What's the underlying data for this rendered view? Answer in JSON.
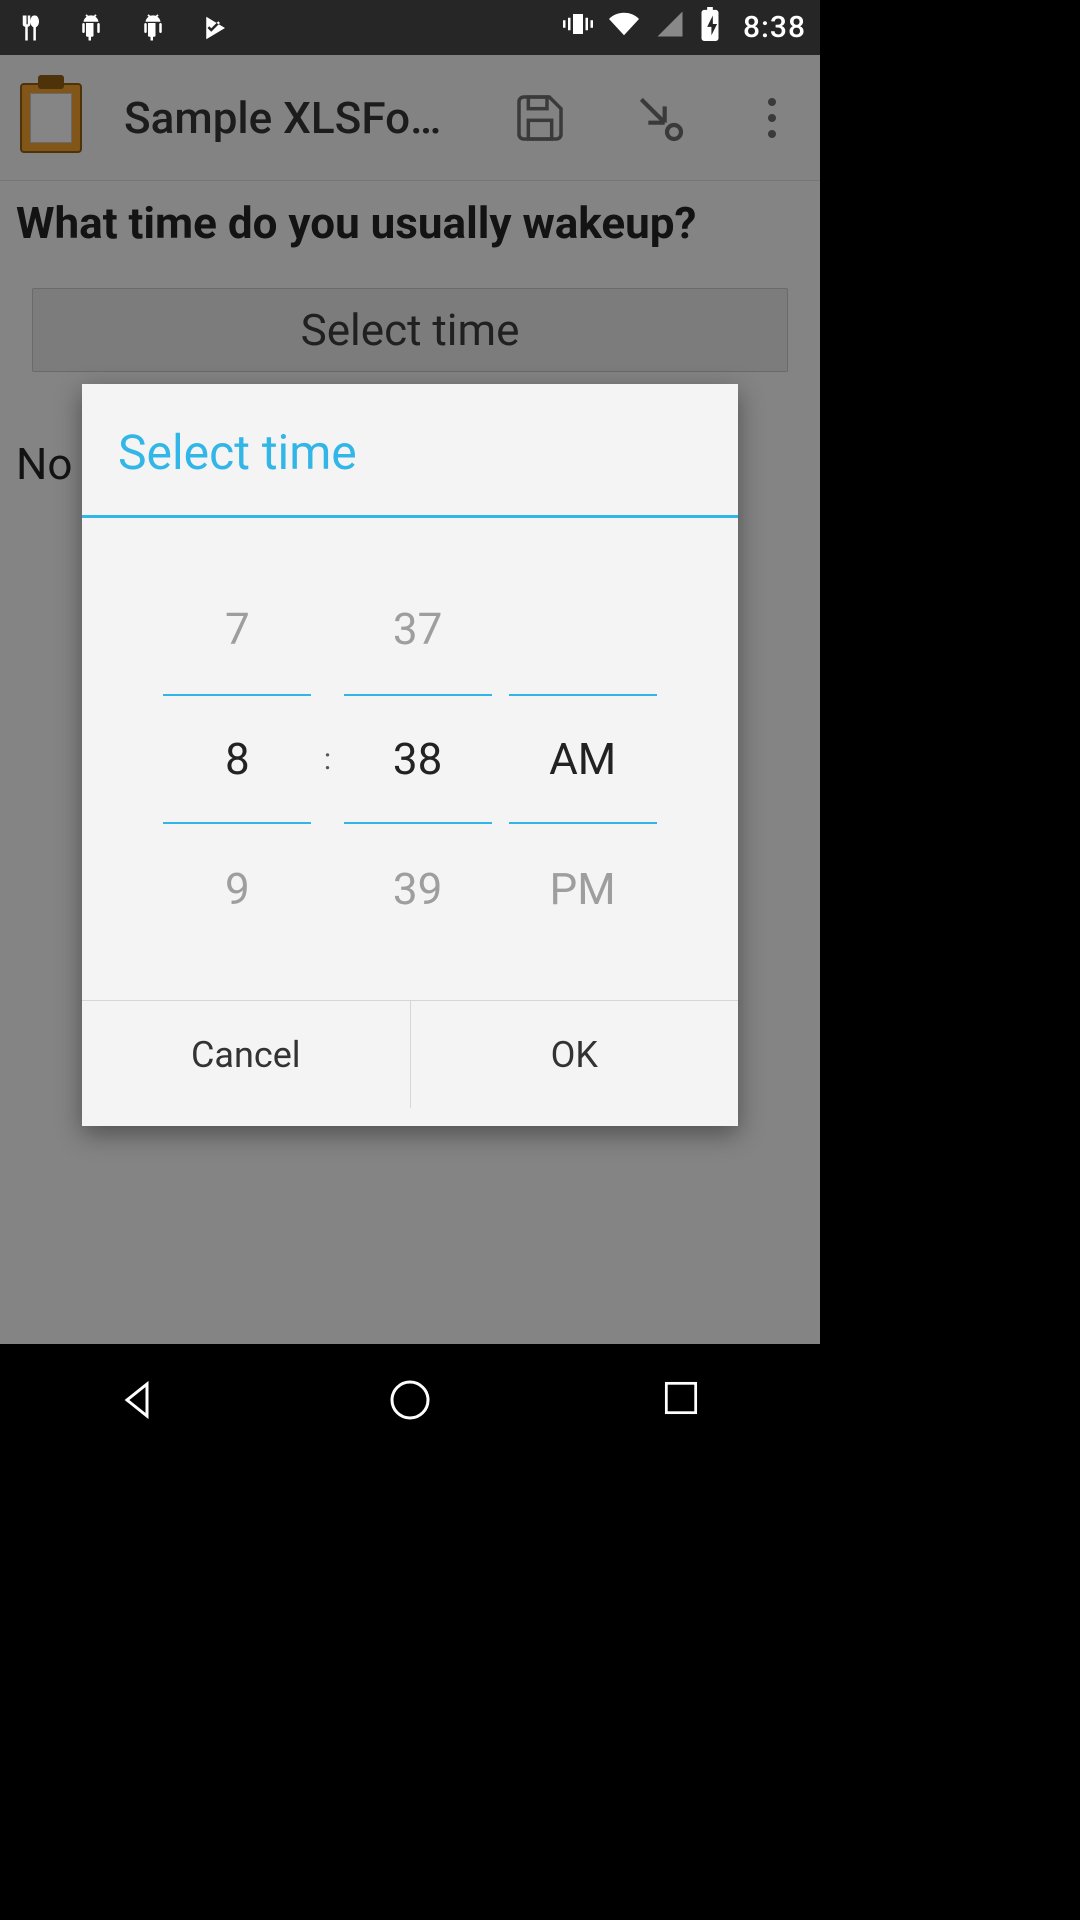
{
  "status_bar": {
    "time": "8:38"
  },
  "app_bar": {
    "title": "Sample XLSFo…"
  },
  "form": {
    "question": "What time do you usually wakeup?",
    "select_time_button": "Select time",
    "no_answer_partial": "No"
  },
  "dialog": {
    "title": "Select time",
    "hour": {
      "prev": "7",
      "current": "8",
      "next": "9"
    },
    "minute": {
      "prev": "37",
      "current": "38",
      "next": "39"
    },
    "ampm": {
      "prev": "",
      "current": "AM",
      "next": "PM"
    },
    "separator": ":",
    "cancel": "Cancel",
    "ok": "OK"
  },
  "colors": {
    "accent": "#31b6e7"
  }
}
